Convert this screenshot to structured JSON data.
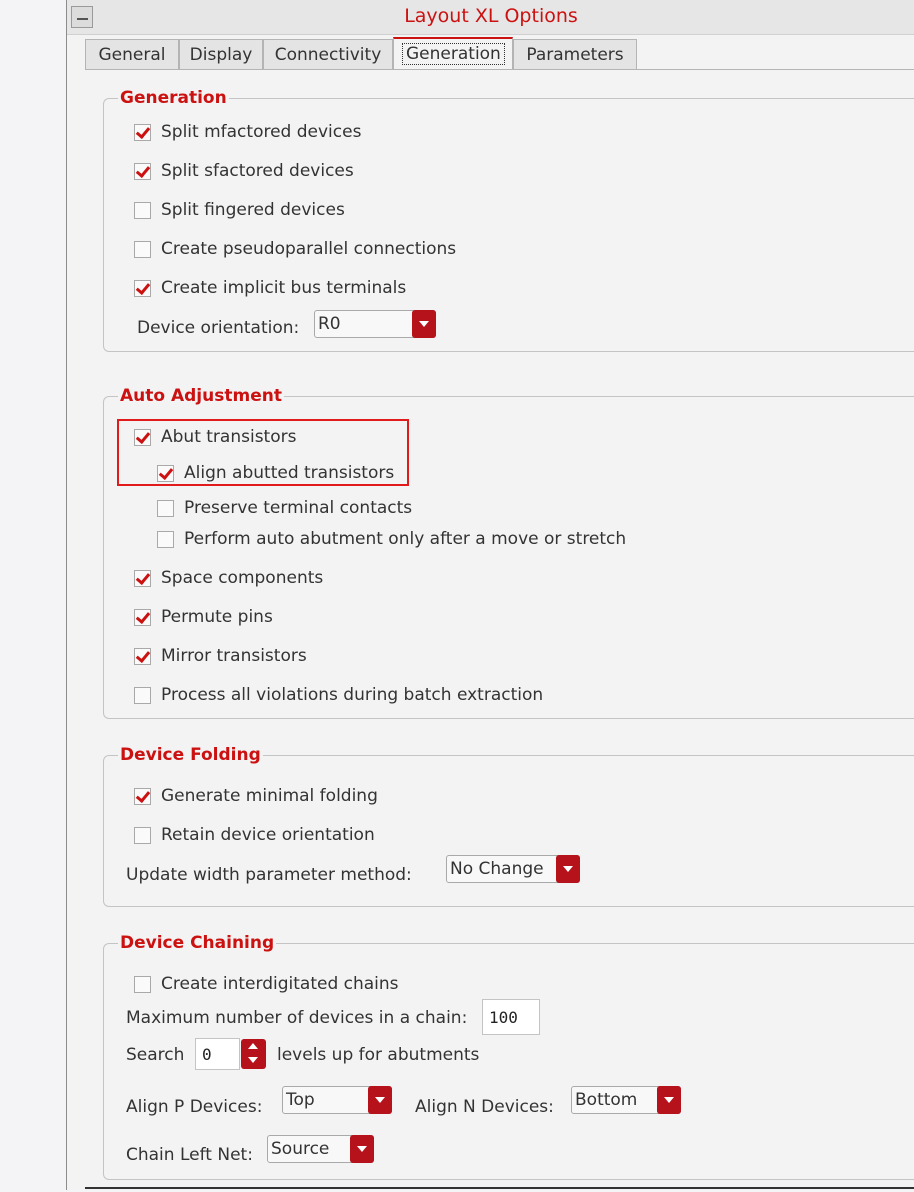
{
  "window": {
    "title": "Layout XL Options"
  },
  "tabs": [
    "General",
    "Display",
    "Connectivity",
    "Generation",
    "Parameters"
  ],
  "generation": {
    "heading": "Generation",
    "options": [
      {
        "label": "Split mfactored devices",
        "checked": true
      },
      {
        "label": "Split sfactored devices",
        "checked": true
      },
      {
        "label": "Split fingered devices",
        "checked": false
      },
      {
        "label": "Create pseudoparallel connections",
        "checked": false
      },
      {
        "label": "Create implicit bus terminals",
        "checked": true
      }
    ],
    "orientation_label": "Device orientation:",
    "orientation_value": "R0"
  },
  "auto_adjustment": {
    "heading": "Auto Adjustment",
    "options": [
      {
        "label": "Abut transistors",
        "checked": true
      },
      {
        "label": "Align abutted transistors",
        "checked": true
      },
      {
        "label": "Preserve terminal contacts",
        "checked": false
      },
      {
        "label": "Perform auto abutment only after a move or stretch",
        "checked": false
      },
      {
        "label": "Space components",
        "checked": true
      },
      {
        "label": "Permute pins",
        "checked": true
      },
      {
        "label": "Mirror transistors",
        "checked": true
      },
      {
        "label": "Process all violations during batch extraction",
        "checked": false
      }
    ]
  },
  "device_folding": {
    "heading": "Device Folding",
    "options": [
      {
        "label": "Generate minimal folding",
        "checked": true
      },
      {
        "label": "Retain device orientation",
        "checked": false
      }
    ],
    "width_method_label": "Update width parameter method:",
    "width_method_value": "No Change"
  },
  "device_chaining": {
    "heading": "Device Chaining",
    "interdigitated": {
      "label": "Create interdigitated chains",
      "checked": false
    },
    "max_devices_label": "Maximum number of devices in a chain:",
    "max_devices_value": "100",
    "search_label": "Search",
    "search_value": "0",
    "search_suffix": "levels up for abutments",
    "align_p_label": "Align P Devices:",
    "align_p_value": "Top",
    "align_n_label": "Align N Devices:",
    "align_n_value": "Bottom",
    "chain_left_label": "Chain Left Net:",
    "chain_left_value": "Source"
  },
  "colors": {
    "accent": "#cc1111",
    "button": "#b5121b"
  }
}
